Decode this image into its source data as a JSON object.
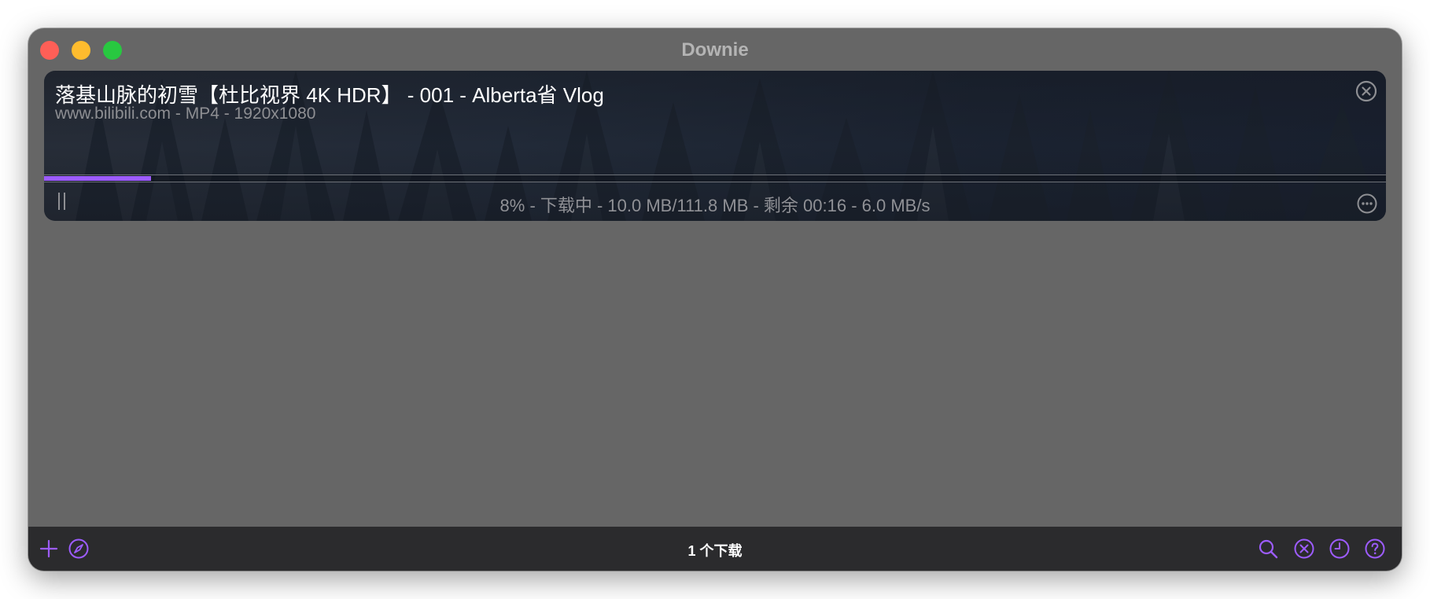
{
  "window": {
    "title": "Downie"
  },
  "download_item": {
    "title": "落基山脉的初雪【杜比视界 4K HDR】 - 001 - Alberta省 Vlog",
    "subtitle": "www.bilibili.com - MP4 - 1920x1080",
    "progress_percent": 8,
    "status": "8% - 下载中 - 10.0 MB/111.8 MB - 剩余 00:16 - 6.0 MB/s"
  },
  "toolbar": {
    "download_count": "1 个下载",
    "left_icons": [
      "plus-icon",
      "compass-icon"
    ],
    "right_icons": [
      "search-icon",
      "clear-icon",
      "history-icon",
      "help-icon"
    ]
  },
  "colors": {
    "accent": "#9d5cff",
    "window_bg": "#666666",
    "toolbar_bg": "#2b2b2d"
  }
}
